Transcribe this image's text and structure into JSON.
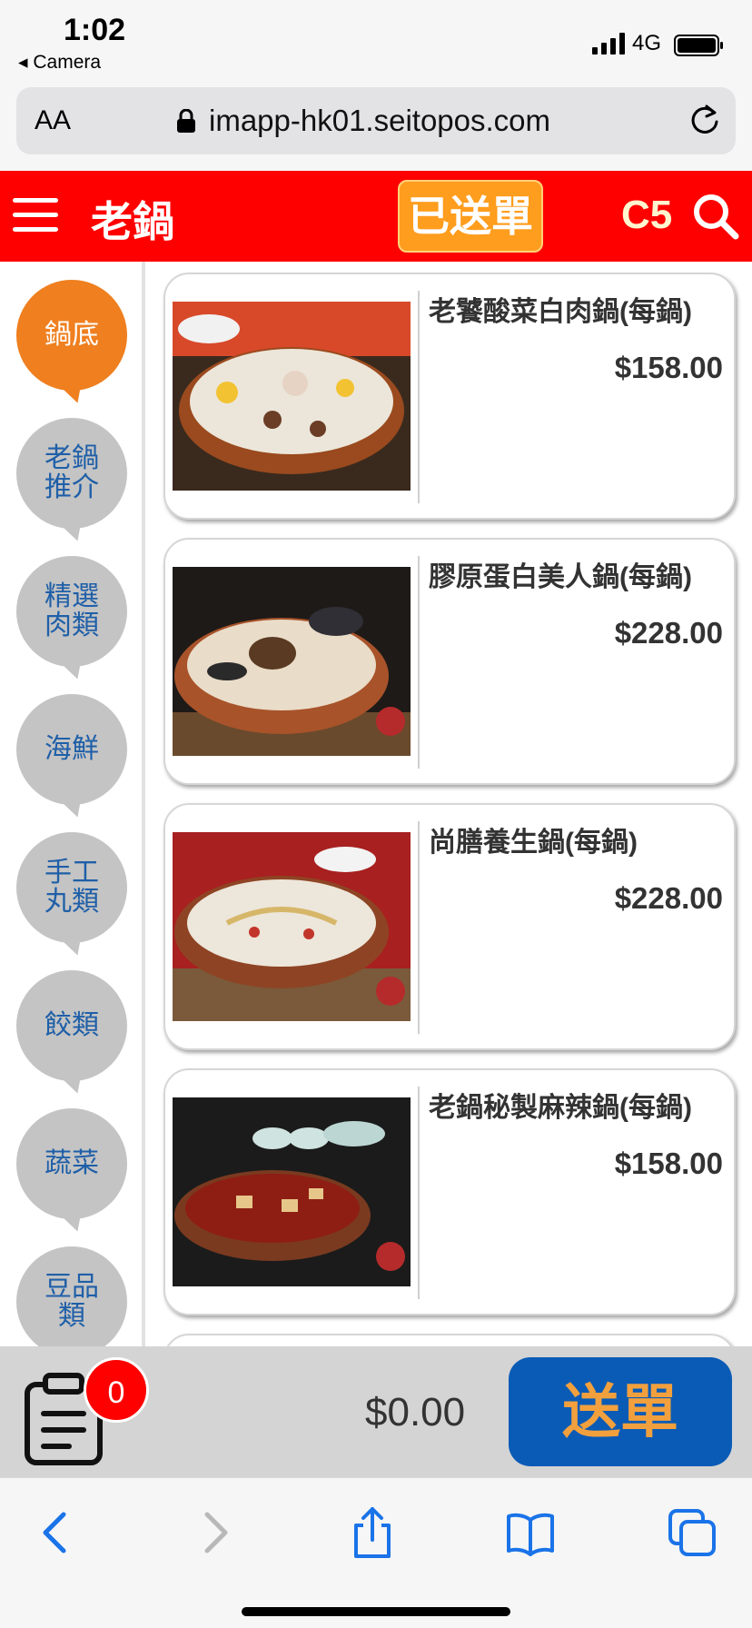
{
  "status_bar": {
    "time": "1:02",
    "back_app": "◂ Camera",
    "network": "4G"
  },
  "browser": {
    "text_size": "AA",
    "url": "imapp-hk01.seitopos.com"
  },
  "header": {
    "title": "老鍋",
    "sent_orders_label": "已送單",
    "table_number": "C5",
    "bg_color": "#ff0000",
    "sent_button_color": "#ff9d1e"
  },
  "categories": [
    {
      "label": "鍋底",
      "active": true
    },
    {
      "label": "老鍋推介",
      "active": false
    },
    {
      "label": "精選肉類",
      "active": false
    },
    {
      "label": "海鮮",
      "active": false
    },
    {
      "label": "手工丸類",
      "active": false
    },
    {
      "label": "餃類",
      "active": false
    },
    {
      "label": "蔬菜",
      "active": false
    },
    {
      "label": "豆品類",
      "active": false
    }
  ],
  "items": [
    {
      "name": "老饕酸菜白肉鍋(每鍋)",
      "price": "$158.00"
    },
    {
      "name": "膠原蛋白美人鍋(每鍋)",
      "price": "$228.00"
    },
    {
      "name": "尚膳養生鍋(每鍋)",
      "price": "$228.00"
    },
    {
      "name": "老鍋秘製麻辣鍋(每鍋)",
      "price": "$158.00"
    }
  ],
  "order_bar": {
    "item_count": "0",
    "total": "$0.00",
    "send_label": "送單",
    "send_button_color": "#0a5bb6"
  },
  "toolbar_icons": [
    "back-icon",
    "forward-icon",
    "share-icon",
    "bookmarks-icon",
    "tabs-icon"
  ]
}
